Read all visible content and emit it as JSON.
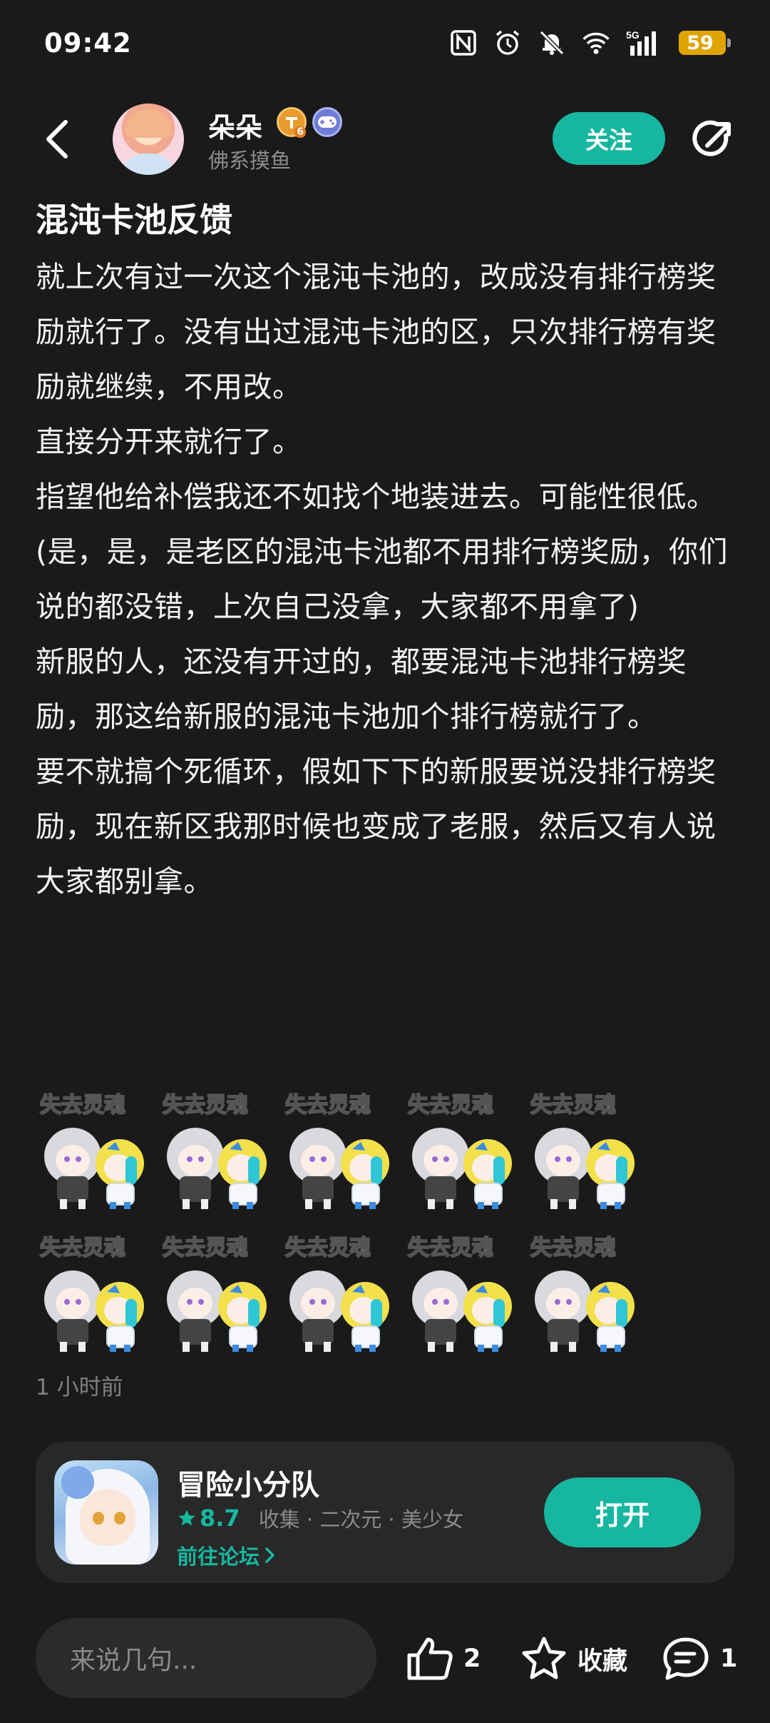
{
  "status_bar": {
    "time": "09:42",
    "icons": [
      "nfc-icon",
      "alarm-icon",
      "mute-icon",
      "wifi-icon",
      "signal-5g-icon"
    ],
    "signal_label": "5G",
    "battery": "59"
  },
  "header": {
    "author_name": "朵朵",
    "author_subtitle": "佛系摸鱼",
    "level_badge": "6",
    "follow_label": "关注"
  },
  "post": {
    "title": "混沌卡池反馈",
    "paragraphs": [
      "就上次有过一次这个混沌卡池的，改成没有排行榜奖励就行了。没有出过混沌卡池的区，只次排行榜有奖励就继续，不用改。",
      "直接分开来就行了。",
      "指望他给补偿我还不如找个地装进去。可能性很低。",
      "(是，是，是老区的混沌卡池都不用排行榜奖励，你们说的都没错，上次自己没拿，大家都不用拿了)",
      "新服的人，还没有开过的，都要混沌卡池排行榜奖励，那这给新服的混沌卡池加个排行榜就行了。",
      "要不就搞个死循环，假如下下的新服要说没排行榜奖励，现在新区我那时候也变成了老服，然后又有人说大家都别拿。"
    ],
    "sticker_caption": "失去灵魂",
    "sticker_count": 10,
    "timestamp": "1 小时前"
  },
  "game_card": {
    "name": "冒险小分队",
    "rating": "8.7",
    "tags": "收集 · 二次元 · 美少女",
    "forum_link": "前往论坛",
    "open_label": "打开"
  },
  "bottom_bar": {
    "comment_placeholder": "来说几句...",
    "like_count": "2",
    "favorite_label": "收藏",
    "comment_count": "1"
  },
  "colors": {
    "background": "#1a1a1a",
    "accent": "#17b6a0",
    "card": "#282828",
    "battery": "#e0a400"
  }
}
